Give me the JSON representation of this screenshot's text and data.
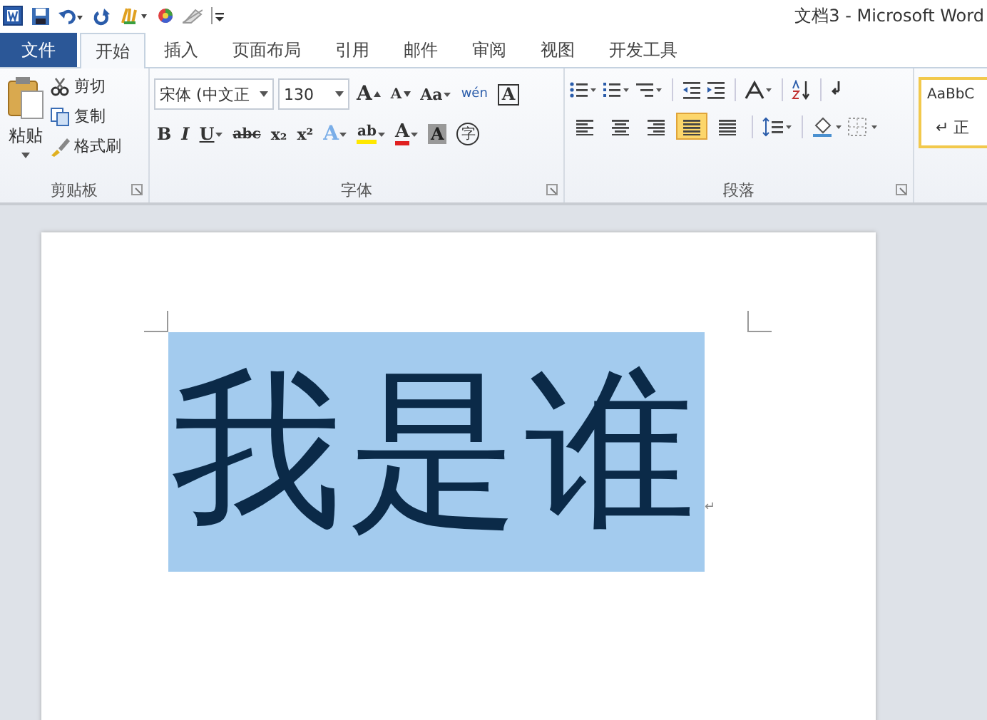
{
  "window": {
    "title": "文档3 - Microsoft Word"
  },
  "tabs": [
    {
      "label": "文件",
      "kind": "file",
      "selected": false
    },
    {
      "label": "开始",
      "kind": "tab",
      "selected": true
    },
    {
      "label": "插入",
      "kind": "tab",
      "selected": false
    },
    {
      "label": "页面布局",
      "kind": "tab",
      "selected": false
    },
    {
      "label": "引用",
      "kind": "tab",
      "selected": false
    },
    {
      "label": "邮件",
      "kind": "tab",
      "selected": false
    },
    {
      "label": "审阅",
      "kind": "tab",
      "selected": false
    },
    {
      "label": "视图",
      "kind": "tab",
      "selected": false
    },
    {
      "label": "开发工具",
      "kind": "tab",
      "selected": false
    }
  ],
  "clipboard": {
    "paste": "粘贴",
    "items": [
      "剪切",
      "复制",
      "格式刷"
    ],
    "label": "剪贴板"
  },
  "font": {
    "name": "宋体 (中文正",
    "size": "130",
    "row1": [
      {
        "label": "A",
        "kind": "grow"
      },
      {
        "label": "A",
        "kind": "shrink"
      },
      {
        "label": "Aa",
        "kind": "case"
      },
      {
        "label": "wén",
        "kind": "phonetic"
      },
      {
        "label": "A",
        "kind": "border"
      }
    ],
    "row2": [
      {
        "label": "B",
        "kind": "bold"
      },
      {
        "label": "I",
        "kind": "italic"
      },
      {
        "label": "U",
        "kind": "underline"
      },
      {
        "label": "abc",
        "kind": "strike"
      },
      {
        "label": "x₂",
        "kind": "sub"
      },
      {
        "label": "x²",
        "kind": "sup"
      },
      {
        "label": "A",
        "kind": "effect"
      },
      {
        "label": "ab",
        "kind": "highlight"
      },
      {
        "label": "A",
        "kind": "color"
      },
      {
        "label": "A",
        "kind": "shade"
      },
      {
        "label": "字",
        "kind": "enclose"
      }
    ],
    "label": "字体"
  },
  "paragraph": {
    "alignment": [
      {
        "selected": false
      },
      {
        "selected": false
      },
      {
        "selected": false
      },
      {
        "selected": true
      },
      {
        "selected": false
      }
    ],
    "label": "段落"
  },
  "styles": {
    "sample": "AaBbC",
    "name": "↵ 正"
  },
  "document": {
    "text": "我是谁",
    "selected": true,
    "mark": "↵"
  }
}
